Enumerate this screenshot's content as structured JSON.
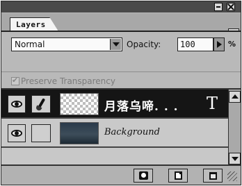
{
  "panel": {
    "tab_label": "Layers",
    "blend_mode": "Normal",
    "opacity_label": "Opacity:",
    "opacity_value": "100",
    "opacity_unit": "%",
    "preserve_label": "Preserve Transparency",
    "preserve_checked": true,
    "preserve_enabled": false
  },
  "layers": [
    {
      "name": "月落乌啼. . .",
      "type_icon": "T",
      "selected": true,
      "visible": true,
      "thumbnail": "transparency-checker"
    },
    {
      "name": "Background",
      "selected": false,
      "visible": true,
      "thumbnail": "dark-image"
    }
  ],
  "icons": {
    "minimize": "minimize-icon",
    "close": "close-icon",
    "panel_menu": "panel-menu-arrow-icon",
    "visibility": "eye-icon",
    "brush": "brush-icon",
    "type_layer": "type-layer-icon",
    "layer_mask": "add-layer-mask-icon",
    "new_layer": "new-layer-icon",
    "trash": "trash-icon"
  }
}
